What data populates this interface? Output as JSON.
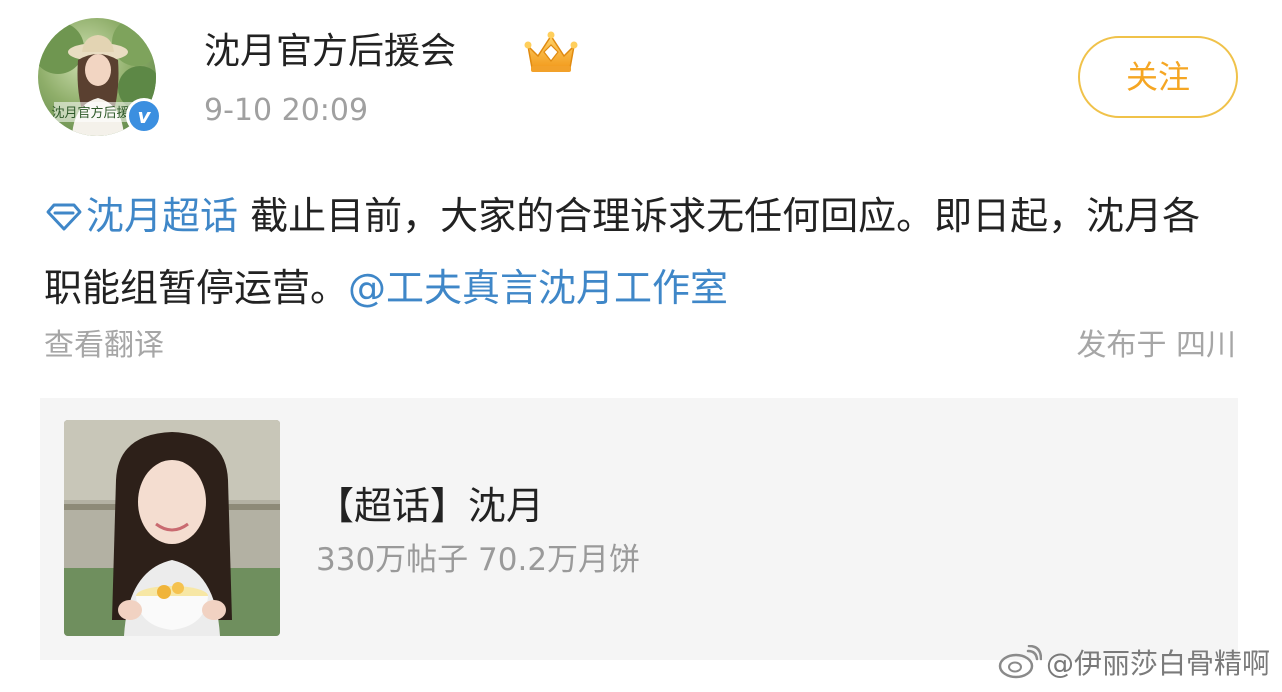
{
  "post": {
    "author": {
      "name": "沈月官方后援会",
      "avatar_caption": "沈月官方后援会",
      "verified_mark": "v",
      "badge_icon": "crown-icon"
    },
    "timestamp": "9-10 20:09",
    "follow_label": "关注",
    "content": {
      "topic_icon": "super-topic-diamond-icon",
      "topic_label": "沈月超话",
      "text": "截止目前，大家的合理诉求无任何回应。即日起，沈月各职能组暂停运营。",
      "mention": "@工夫真言沈月工作室"
    },
    "translate_label": "查看翻译",
    "location": "发布于 四川"
  },
  "card": {
    "title": "【超话】沈月",
    "stats": "330万帖子 70.2万月饼"
  },
  "watermark": {
    "logo_icon": "weibo-logo-icon",
    "text": "@伊丽莎白骨精啊"
  },
  "colors": {
    "link": "#3f87c8",
    "follow_accent": "#f5a623",
    "secondary_text": "#a6a6a6",
    "card_background": "#f5f5f5",
    "verified": "#3b8fe0"
  }
}
